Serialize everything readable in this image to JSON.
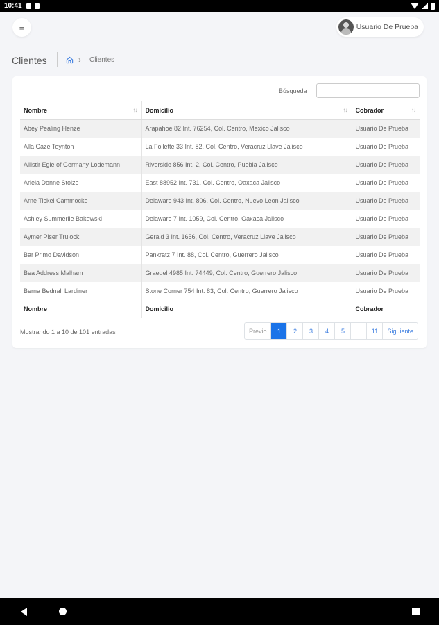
{
  "status_bar": {
    "time": "10:41"
  },
  "header": {
    "user_name": "Usuario De Prueba"
  },
  "page": {
    "title": "Clientes",
    "breadcrumb": {
      "current": "Clientes"
    }
  },
  "search": {
    "label": "Búsqueda",
    "value": ""
  },
  "table": {
    "columns": [
      "Nombre",
      "Domicilio",
      "Cobrador"
    ],
    "rows": [
      [
        "Abey Pealing Henze",
        "Arapahoe 82 Int. 76254, Col. Centro, Mexico Jalisco",
        "Usuario De Prueba"
      ],
      [
        "Alla Caze Toynton",
        "La Follette 33 Int. 82, Col. Centro, Veracruz Llave Jalisco",
        "Usuario De Prueba"
      ],
      [
        "Allistir Egle of Germany Lodemann",
        "Riverside 856 Int. 2, Col. Centro, Puebla Jalisco",
        "Usuario De Prueba"
      ],
      [
        "Ariela Donne Stolze",
        "East 88952 Int. 731, Col. Centro, Oaxaca Jalisco",
        "Usuario De Prueba"
      ],
      [
        "Arne Tickel Cammocke",
        "Delaware 943 Int. 806, Col. Centro, Nuevo Leon Jalisco",
        "Usuario De Prueba"
      ],
      [
        "Ashley Summerlie Bakowski",
        "Delaware 7 Int. 1059, Col. Centro, Oaxaca Jalisco",
        "Usuario De Prueba"
      ],
      [
        "Aymer Piser Trulock",
        "Gerald 3 Int. 1656, Col. Centro, Veracruz Llave Jalisco",
        "Usuario De Prueba"
      ],
      [
        "Bar Primo Davidson",
        "Pankratz 7 Int. 88, Col. Centro, Guerrero Jalisco",
        "Usuario De Prueba"
      ],
      [
        "Bea Address Malham",
        "Graedel 4985 Int. 74449, Col. Centro, Guerrero Jalisco",
        "Usuario De Prueba"
      ],
      [
        "Berna Bednall Lardiner",
        "Stone Corner 754 Int. 83, Col. Centro, Guerrero Jalisco",
        "Usuario De Prueba"
      ]
    ]
  },
  "footer": {
    "info": "Mostrando 1 a 10 de 101 entradas",
    "pagination": {
      "previous": "Previo",
      "pages": [
        "1",
        "2",
        "3",
        "4",
        "5",
        "…",
        "11"
      ],
      "active_page": "1",
      "next": "Siguiente"
    }
  },
  "colors": {
    "accent": "#1a73e8",
    "link": "#3d7ee0",
    "background": "#f4f5f8"
  }
}
